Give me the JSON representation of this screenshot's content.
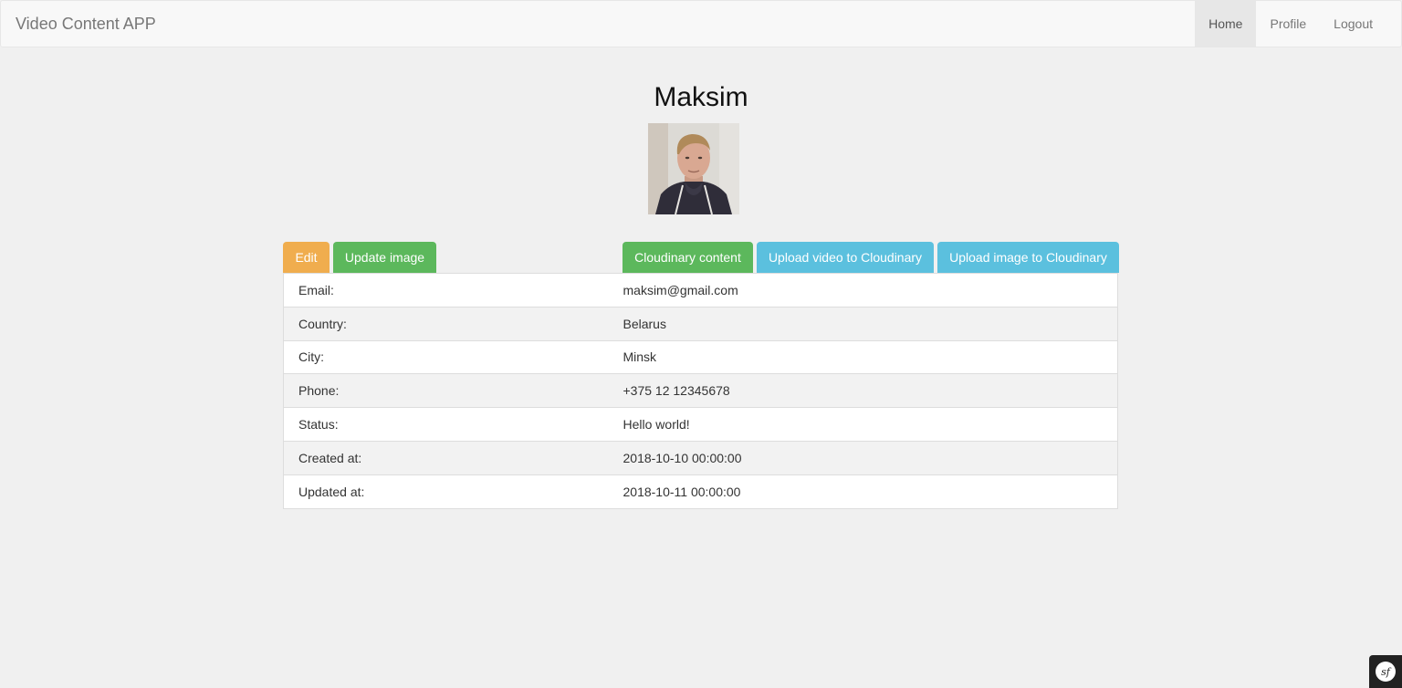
{
  "navbar": {
    "brand": "Video Content APP",
    "items": [
      {
        "label": "Home",
        "active": true
      },
      {
        "label": "Profile",
        "active": false
      },
      {
        "label": "Logout",
        "active": false
      }
    ]
  },
  "profile": {
    "name": "Maksim",
    "avatar_icon": "user-photo"
  },
  "actions": {
    "edit": "Edit",
    "update_image": "Update image",
    "cloudinary_content": "Cloudinary content",
    "upload_video": "Upload video to Cloudinary",
    "upload_image": "Upload image to Cloudinary"
  },
  "details": [
    {
      "label": "Email:",
      "value": "maksim@gmail.com"
    },
    {
      "label": "Country:",
      "value": "Belarus"
    },
    {
      "label": "City:",
      "value": "Minsk"
    },
    {
      "label": "Phone:",
      "value": "+375 12 12345678"
    },
    {
      "label": "Status:",
      "value": "Hello world!"
    },
    {
      "label": "Created at:",
      "value": "2018-10-10 00:00:00"
    },
    {
      "label": "Updated at:",
      "value": "2018-10-11 00:00:00"
    }
  ],
  "colors": {
    "warning": "#f0ad4e",
    "success": "#5cb85c",
    "info": "#5bc0de"
  },
  "toolbar": {
    "symfony_icon": "symfony-logo-icon"
  }
}
